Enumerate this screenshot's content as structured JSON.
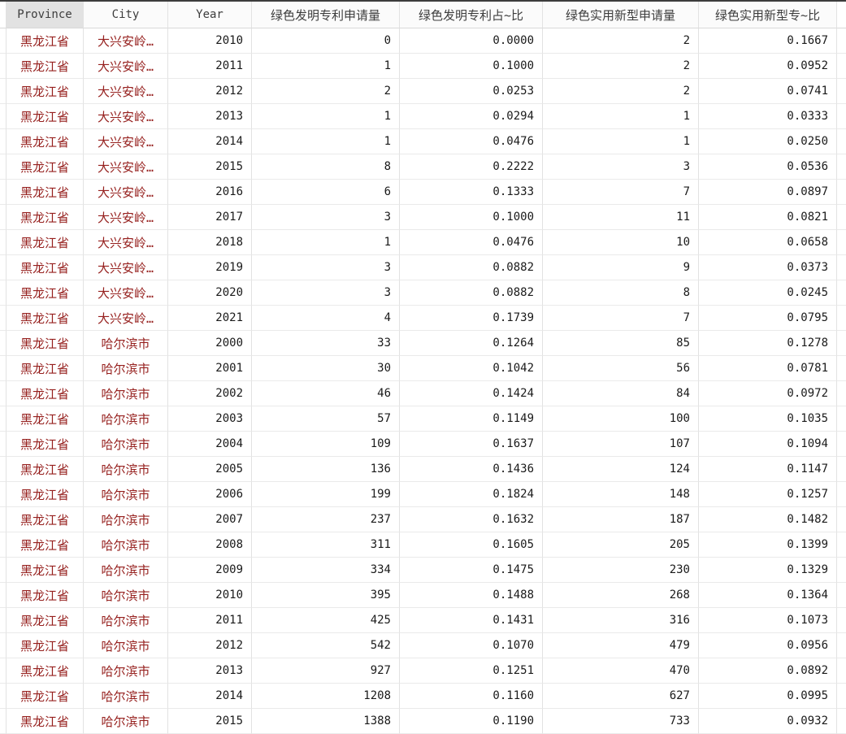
{
  "app": {
    "name": "data-frame-viewer",
    "accent_text_color": "#96201e",
    "header_selected_bg": "#e2e2e2",
    "header_bg": "#fbfbfb",
    "topbar_color": "#3c3c3c"
  },
  "table": {
    "columns": [
      {
        "label": "Province",
        "type": "text",
        "cjk": false,
        "selected": true
      },
      {
        "label": "City",
        "type": "text",
        "cjk": false,
        "selected": false
      },
      {
        "label": "Year",
        "type": "number",
        "cjk": false,
        "selected": false
      },
      {
        "label": "绿色发明专利申请量",
        "type": "number",
        "cjk": true,
        "selected": false
      },
      {
        "label": "绿色发明专利占~比",
        "type": "number",
        "cjk": true,
        "selected": false
      },
      {
        "label": "绿色实用新型申请量",
        "type": "number",
        "cjk": true,
        "selected": false
      },
      {
        "label": "绿色实用新型专~比",
        "type": "number",
        "cjk": true,
        "selected": false
      }
    ],
    "rows": [
      [
        "黑龙江省",
        "大兴安岭…",
        "2010",
        "0",
        "0.0000",
        "2",
        "0.1667"
      ],
      [
        "黑龙江省",
        "大兴安岭…",
        "2011",
        "1",
        "0.1000",
        "2",
        "0.0952"
      ],
      [
        "黑龙江省",
        "大兴安岭…",
        "2012",
        "2",
        "0.0253",
        "2",
        "0.0741"
      ],
      [
        "黑龙江省",
        "大兴安岭…",
        "2013",
        "1",
        "0.0294",
        "1",
        "0.0333"
      ],
      [
        "黑龙江省",
        "大兴安岭…",
        "2014",
        "1",
        "0.0476",
        "1",
        "0.0250"
      ],
      [
        "黑龙江省",
        "大兴安岭…",
        "2015",
        "8",
        "0.2222",
        "3",
        "0.0536"
      ],
      [
        "黑龙江省",
        "大兴安岭…",
        "2016",
        "6",
        "0.1333",
        "7",
        "0.0897"
      ],
      [
        "黑龙江省",
        "大兴安岭…",
        "2017",
        "3",
        "0.1000",
        "11",
        "0.0821"
      ],
      [
        "黑龙江省",
        "大兴安岭…",
        "2018",
        "1",
        "0.0476",
        "10",
        "0.0658"
      ],
      [
        "黑龙江省",
        "大兴安岭…",
        "2019",
        "3",
        "0.0882",
        "9",
        "0.0373"
      ],
      [
        "黑龙江省",
        "大兴安岭…",
        "2020",
        "3",
        "0.0882",
        "8",
        "0.0245"
      ],
      [
        "黑龙江省",
        "大兴安岭…",
        "2021",
        "4",
        "0.1739",
        "7",
        "0.0795"
      ],
      [
        "黑龙江省",
        "哈尔滨市",
        "2000",
        "33",
        "0.1264",
        "85",
        "0.1278"
      ],
      [
        "黑龙江省",
        "哈尔滨市",
        "2001",
        "30",
        "0.1042",
        "56",
        "0.0781"
      ],
      [
        "黑龙江省",
        "哈尔滨市",
        "2002",
        "46",
        "0.1424",
        "84",
        "0.0972"
      ],
      [
        "黑龙江省",
        "哈尔滨市",
        "2003",
        "57",
        "0.1149",
        "100",
        "0.1035"
      ],
      [
        "黑龙江省",
        "哈尔滨市",
        "2004",
        "109",
        "0.1637",
        "107",
        "0.1094"
      ],
      [
        "黑龙江省",
        "哈尔滨市",
        "2005",
        "136",
        "0.1436",
        "124",
        "0.1147"
      ],
      [
        "黑龙江省",
        "哈尔滨市",
        "2006",
        "199",
        "0.1824",
        "148",
        "0.1257"
      ],
      [
        "黑龙江省",
        "哈尔滨市",
        "2007",
        "237",
        "0.1632",
        "187",
        "0.1482"
      ],
      [
        "黑龙江省",
        "哈尔滨市",
        "2008",
        "311",
        "0.1605",
        "205",
        "0.1399"
      ],
      [
        "黑龙江省",
        "哈尔滨市",
        "2009",
        "334",
        "0.1475",
        "230",
        "0.1329"
      ],
      [
        "黑龙江省",
        "哈尔滨市",
        "2010",
        "395",
        "0.1488",
        "268",
        "0.1364"
      ],
      [
        "黑龙江省",
        "哈尔滨市",
        "2011",
        "425",
        "0.1431",
        "316",
        "0.1073"
      ],
      [
        "黑龙江省",
        "哈尔滨市",
        "2012",
        "542",
        "0.1070",
        "479",
        "0.0956"
      ],
      [
        "黑龙江省",
        "哈尔滨市",
        "2013",
        "927",
        "0.1251",
        "470",
        "0.0892"
      ],
      [
        "黑龙江省",
        "哈尔滨市",
        "2014",
        "1208",
        "0.1160",
        "627",
        "0.0995"
      ],
      [
        "黑龙江省",
        "哈尔滨市",
        "2015",
        "1388",
        "0.1190",
        "733",
        "0.0932"
      ]
    ]
  }
}
